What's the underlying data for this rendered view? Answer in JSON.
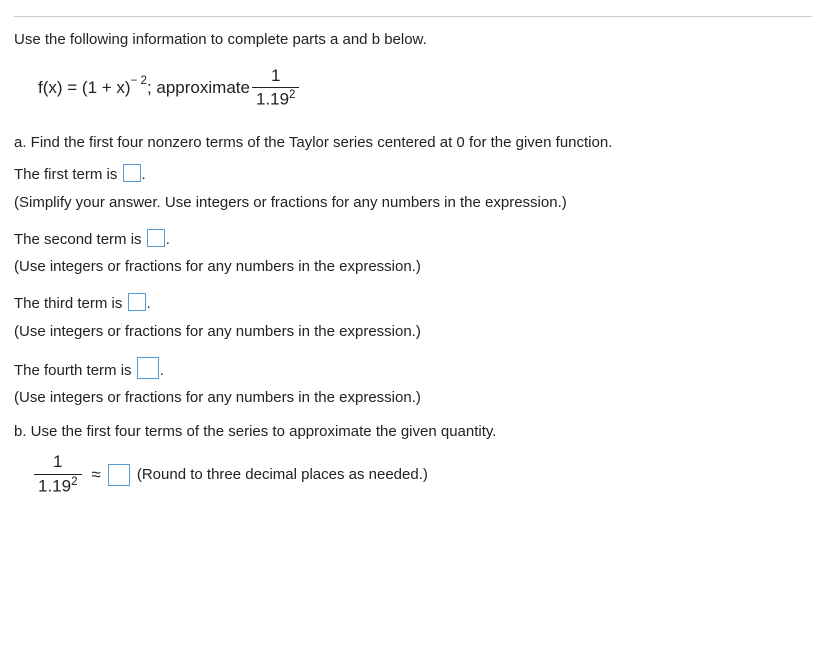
{
  "intro": "Use the following information to complete parts a and b below.",
  "formula": {
    "fx_prefix": "f(x) = (1 + x)",
    "exponent": "− 2",
    "sep": "; approximate ",
    "frac_num": "1",
    "frac_den_base": "1.19",
    "frac_den_exp": "2"
  },
  "partA": {
    "prompt": "a. Find the first four nonzero terms of the Taylor series centered at 0 for the given function.",
    "term1_label": "The first term is ",
    "term1_hint": "(Simplify your answer. Use integers or fractions for any numbers in the expression.)",
    "term2_label": "The second term is ",
    "term2_hint": "(Use integers or fractions for any numbers in the expression.)",
    "term3_label": "The third term is ",
    "term3_hint": "(Use integers or fractions for any numbers in the expression.)",
    "term4_label": "The fourth term is ",
    "term4_hint": "(Use integers or fractions for any numbers in the expression.)",
    "period": "."
  },
  "partB": {
    "prompt": "b. Use the first four terms of the series to approximate the given quantity.",
    "frac_num": "1",
    "frac_den_base": "1.19",
    "frac_den_exp": "2",
    "approx_symbol": "≈",
    "note": "(Round to three decimal places as needed.)"
  }
}
